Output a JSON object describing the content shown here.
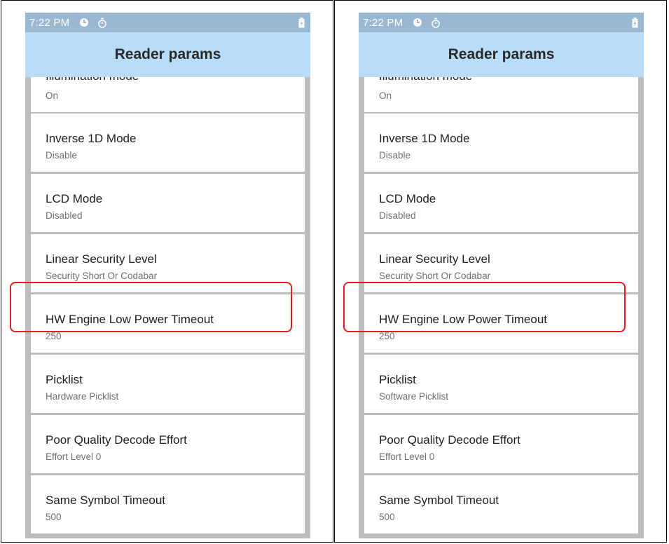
{
  "accent_highlight_color": "#e02020",
  "panels": [
    {
      "status": {
        "time": "7:22 PM"
      },
      "app_title": "Reader params",
      "items": [
        {
          "title": "Illumination mode",
          "value": "On"
        },
        {
          "title": "Inverse 1D Mode",
          "value": "Disable"
        },
        {
          "title": "LCD Mode",
          "value": "Disabled"
        },
        {
          "title": "Linear Security Level",
          "value": "Security Short Or Codabar"
        },
        {
          "title": "HW Engine Low Power Timeout",
          "value": "250"
        },
        {
          "title": "Picklist",
          "value": "Hardware Picklist"
        },
        {
          "title": "Poor Quality Decode Effort",
          "value": "Effort Level 0"
        },
        {
          "title": "Same Symbol Timeout",
          "value": "500"
        }
      ]
    },
    {
      "status": {
        "time": "7:22 PM"
      },
      "app_title": "Reader params",
      "items": [
        {
          "title": "Illumination mode",
          "value": "On"
        },
        {
          "title": "Inverse 1D Mode",
          "value": "Disable"
        },
        {
          "title": "LCD Mode",
          "value": "Disabled"
        },
        {
          "title": "Linear Security Level",
          "value": "Security Short Or Codabar"
        },
        {
          "title": "HW Engine Low Power Timeout",
          "value": "250"
        },
        {
          "title": "Picklist",
          "value": "Software Picklist"
        },
        {
          "title": "Poor Quality Decode Effort",
          "value": "Effort Level 0"
        },
        {
          "title": "Same Symbol Timeout",
          "value": "500"
        }
      ]
    }
  ]
}
